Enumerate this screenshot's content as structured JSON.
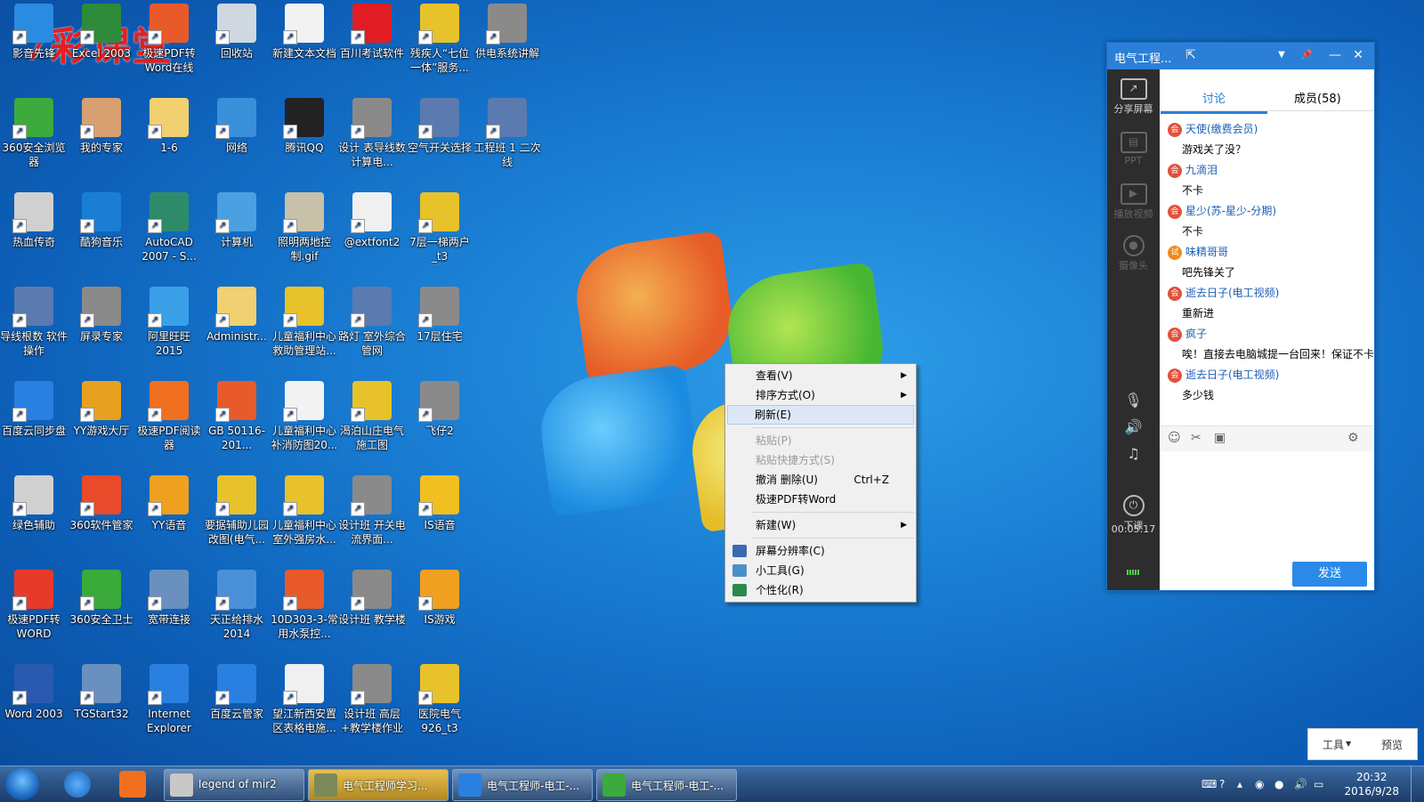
{
  "watermark": "7彩课堂",
  "desktop_icons": [
    {
      "label": "影音先锋",
      "color": "#2a8be0"
    },
    {
      "label": "Excel 2003",
      "color": "#2e8b3a"
    },
    {
      "label": "极速PDF转Word在线",
      "color": "#e85a2a"
    },
    {
      "label": "回收站",
      "color": "#cfd8e0"
    },
    {
      "label": "新建文本文档",
      "color": "#f2f2f2"
    },
    {
      "label": "百川考试软件",
      "color": "#e11d24"
    },
    {
      "label": "残疾人“七位一体”服务...",
      "color": "#e8c22a"
    },
    {
      "label": "供电系统讲解",
      "color": "#8a8a8a"
    },
    {
      "label": "360安全浏览器",
      "color": "#3caa3c"
    },
    {
      "label": "我的专家",
      "color": "#d8a070"
    },
    {
      "label": "1-6",
      "color": "#f0d070"
    },
    {
      "label": "网络",
      "color": "#3a90d8"
    },
    {
      "label": "腾讯QQ",
      "color": "#222222"
    },
    {
      "label": "设计 表导线数 计算电...",
      "color": "#8a8a8a"
    },
    {
      "label": "空气开关选择",
      "color": "#5a7ab0"
    },
    {
      "label": "工程班 1 二次线",
      "color": "#5a7ab0"
    },
    {
      "label": "热血传奇",
      "color": "#d0d0d0"
    },
    {
      "label": "酷狗音乐",
      "color": "#1a7fd4"
    },
    {
      "label": "AutoCAD 2007 - S...",
      "color": "#2e8b6a"
    },
    {
      "label": "计算机",
      "color": "#4aa0e0"
    },
    {
      "label": "照明两地控制.gif",
      "color": "#c8c0a8"
    },
    {
      "label": "@extfont2",
      "color": "#f0f0f0"
    },
    {
      "label": "7层一梯两户_t3",
      "color": "#e8c22a"
    },
    {
      "label": "导线根数 软件操作",
      "color": "#5a7ab0"
    },
    {
      "label": "屏录专家",
      "color": "#8a8a8a"
    },
    {
      "label": "阿里旺旺2015",
      "color": "#3aa0e8"
    },
    {
      "label": "Administr...",
      "color": "#f0d070"
    },
    {
      "label": "儿童福利中心救助管理站...",
      "color": "#e8c22a"
    },
    {
      "label": "路灯 室外综合管网",
      "color": "#5a7ab0"
    },
    {
      "label": "17层住宅",
      "color": "#8a8a8a"
    },
    {
      "label": "百度云同步盘",
      "color": "#2a80e0"
    },
    {
      "label": "YY游戏大厅",
      "color": "#e8a020"
    },
    {
      "label": "极速PDF阅读器",
      "color": "#f07020"
    },
    {
      "label": "GB 50116-201...",
      "color": "#e85a2a"
    },
    {
      "label": "儿童福利中心补消防图20...",
      "color": "#f2f2f2"
    },
    {
      "label": "渴泊山庄电气施工图_t6_t...",
      "color": "#e8c22a"
    },
    {
      "label": "飞仔2",
      "color": "#8a8a8a"
    },
    {
      "label": "绿色辅助",
      "color": "#d0d0d0"
    },
    {
      "label": "360软件管家",
      "color": "#e84a2a"
    },
    {
      "label": "YY语音",
      "color": "#f0a020"
    },
    {
      "label": "要据辅助儿园改图(电气...",
      "color": "#e8c22a"
    },
    {
      "label": "儿童福利中心室外强房水...",
      "color": "#e8c22a"
    },
    {
      "label": "设计班 开关电流界面...",
      "color": "#8a8a8a"
    },
    {
      "label": "IS语音",
      "color": "#f0c020"
    },
    {
      "label": "极速PDF转WORD",
      "color": "#e83a2a"
    },
    {
      "label": "360安全卫士",
      "color": "#3aaa3a"
    },
    {
      "label": "宽带连接",
      "color": "#6a90c0"
    },
    {
      "label": "天正给排水2014",
      "color": "#4a90d8"
    },
    {
      "label": "10D303-3-常用水泵控...",
      "color": "#e85a2a"
    },
    {
      "label": "设计班 教学楼",
      "color": "#8a8a8a"
    },
    {
      "label": "IS游戏",
      "color": "#f0a020"
    },
    {
      "label": "Word 2003",
      "color": "#2a5ab0"
    },
    {
      "label": "TGStart32",
      "color": "#6a90c0"
    },
    {
      "label": "Internet Explorer",
      "color": "#2a80e0"
    },
    {
      "label": "百度云管家",
      "color": "#2a80e0"
    },
    {
      "label": "望江新西安置区表格电施...",
      "color": "#f0f0f0"
    },
    {
      "label": "设计班 高层+教学楼作业",
      "color": "#8a8a8a"
    },
    {
      "label": "医院电气926_t3",
      "color": "#e8c22a"
    }
  ],
  "context_menu": {
    "items": [
      {
        "label": "查看(V)",
        "arrow": "▶",
        "shortcut": "",
        "state": "normal",
        "icon": ""
      },
      {
        "label": "排序方式(O)",
        "arrow": "▶",
        "shortcut": "",
        "state": "normal",
        "icon": ""
      },
      {
        "label": "刷新(E)",
        "arrow": "",
        "shortcut": "",
        "state": "highlight",
        "icon": ""
      },
      {
        "sep": true
      },
      {
        "label": "粘贴(P)",
        "arrow": "",
        "shortcut": "",
        "state": "disabled",
        "icon": ""
      },
      {
        "label": "粘贴快捷方式(S)",
        "arrow": "",
        "shortcut": "",
        "state": "disabled",
        "icon": ""
      },
      {
        "label": "撤消 删除(U)",
        "arrow": "",
        "shortcut": "Ctrl+Z",
        "state": "normal",
        "icon": ""
      },
      {
        "label": "极速PDF转Word",
        "arrow": "",
        "shortcut": "",
        "state": "normal",
        "icon": ""
      },
      {
        "sep": true
      },
      {
        "label": "新建(W)",
        "arrow": "▶",
        "shortcut": "",
        "state": "normal",
        "icon": ""
      },
      {
        "sep": true
      },
      {
        "label": "屏幕分辨率(C)",
        "arrow": "",
        "shortcut": "",
        "state": "normal",
        "icon": "#3a6ab0"
      },
      {
        "label": "小工具(G)",
        "arrow": "",
        "shortcut": "",
        "state": "normal",
        "icon": "#4a90c8"
      },
      {
        "label": "个性化(R)",
        "arrow": "",
        "shortcut": "",
        "state": "normal",
        "icon": "#2a8a4a"
      }
    ]
  },
  "chat": {
    "title": "电气工程...",
    "title_buttons": {
      "popout": "⇱",
      "dropdown": "▼",
      "pin": "📌",
      "minimize": "—",
      "close": "✕"
    },
    "side": {
      "share_screen": "分享屏幕",
      "ppt": "PPT",
      "play_video": "播放视频",
      "camera": "摄像头",
      "end_class": "下课",
      "timer": "00:05:17"
    },
    "tabs": {
      "discuss": "讨论",
      "members": "成员(58)"
    },
    "messages": [
      {
        "user": "天使(缴费会员)",
        "badge": "会",
        "text": "游戏关了没？"
      },
      {
        "user": "九滴泪",
        "badge": "会",
        "text": "不卡"
      },
      {
        "user": "星少(苏-星少-分期)",
        "badge": "会",
        "text": "不卡"
      },
      {
        "user": "味精哥哥",
        "badge": "试",
        "text": "吧先锋关了"
      },
      {
        "user": "逝去日子(电工视频)",
        "badge": "会",
        "text": "重新进"
      },
      {
        "user": "疯子",
        "badge": "会",
        "text": "唉！直接去电脑城提一台回来！保证不卡"
      },
      {
        "user": "逝去日子(电工视频)",
        "badge": "会",
        "text": "多少钱"
      }
    ],
    "send_label": "发送"
  },
  "bottom_panel": {
    "tools": "工具",
    "preview": "预览"
  },
  "taskbar": {
    "buttons": [
      {
        "label": "legend of mir2",
        "color": "#c8c8c8"
      },
      {
        "label": "电气工程师学习...",
        "color": "#7a8a5a"
      },
      {
        "label": "电气工程师-电工-...",
        "color": "#2a80e0"
      },
      {
        "label": "电气工程师-电工-...",
        "color": "#3caa3c"
      }
    ],
    "time": "20:32",
    "date": "2016/9/28"
  }
}
